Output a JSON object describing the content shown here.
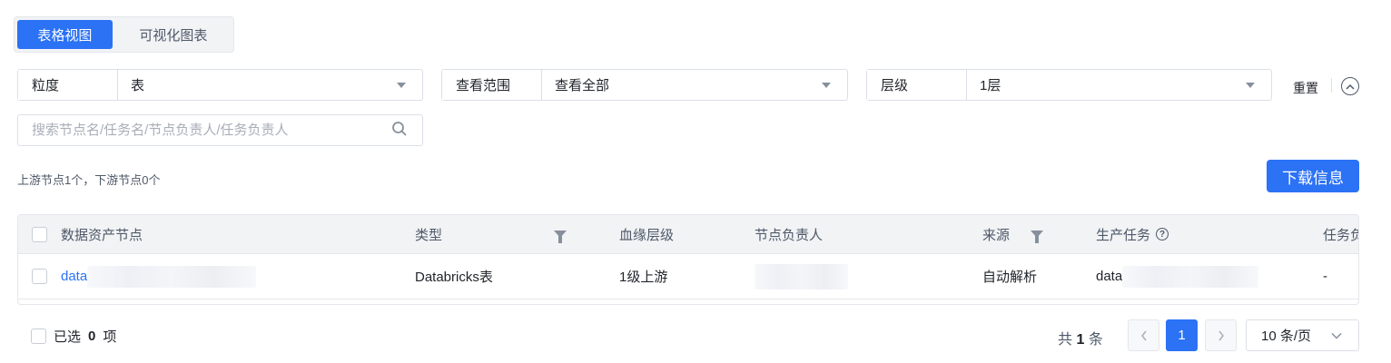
{
  "view_switch": {
    "tabs": [
      {
        "label": "表格视图",
        "active": true
      },
      {
        "label": "可视化图表",
        "active": false
      }
    ]
  },
  "filters": [
    {
      "label": "粒度",
      "value": "表"
    },
    {
      "label": "查看范围",
      "value": "查看全部"
    },
    {
      "label": "层级",
      "value": "1层"
    }
  ],
  "reset_label": "重置",
  "search": {
    "placeholder": "搜索节点名/任务名/节点负责人/任务负责人",
    "value": ""
  },
  "summary": "上游节点1个，下游节点0个",
  "download_label": "下载信息",
  "table": {
    "columns": [
      "数据资产节点",
      "类型",
      "血缘层级",
      "节点负责人",
      "来源",
      "生产任务",
      "任务负"
    ],
    "rows": [
      {
        "asset": "data",
        "type": "Databricks表",
        "level": "1级上游",
        "owner": "",
        "source": "自动解析",
        "task": "data",
        "task_owner": "-"
      }
    ]
  },
  "footer": {
    "selected_prefix": "已选",
    "selected_count": "0",
    "selected_suffix": "项",
    "total_prefix": "共",
    "total_count": "1",
    "total_suffix": "条",
    "current_page": "1",
    "page_size": "10 条/页"
  },
  "colors": {
    "primary": "#2b72f5",
    "header_bg": "#f2f3f5",
    "border": "#dcdfe6"
  },
  "icons": [
    "caret-down-icon",
    "collapse-up-icon",
    "search-icon",
    "filter-icon",
    "help-icon",
    "chevron-left-icon",
    "chevron-right-icon",
    "chevron-down-icon"
  ]
}
